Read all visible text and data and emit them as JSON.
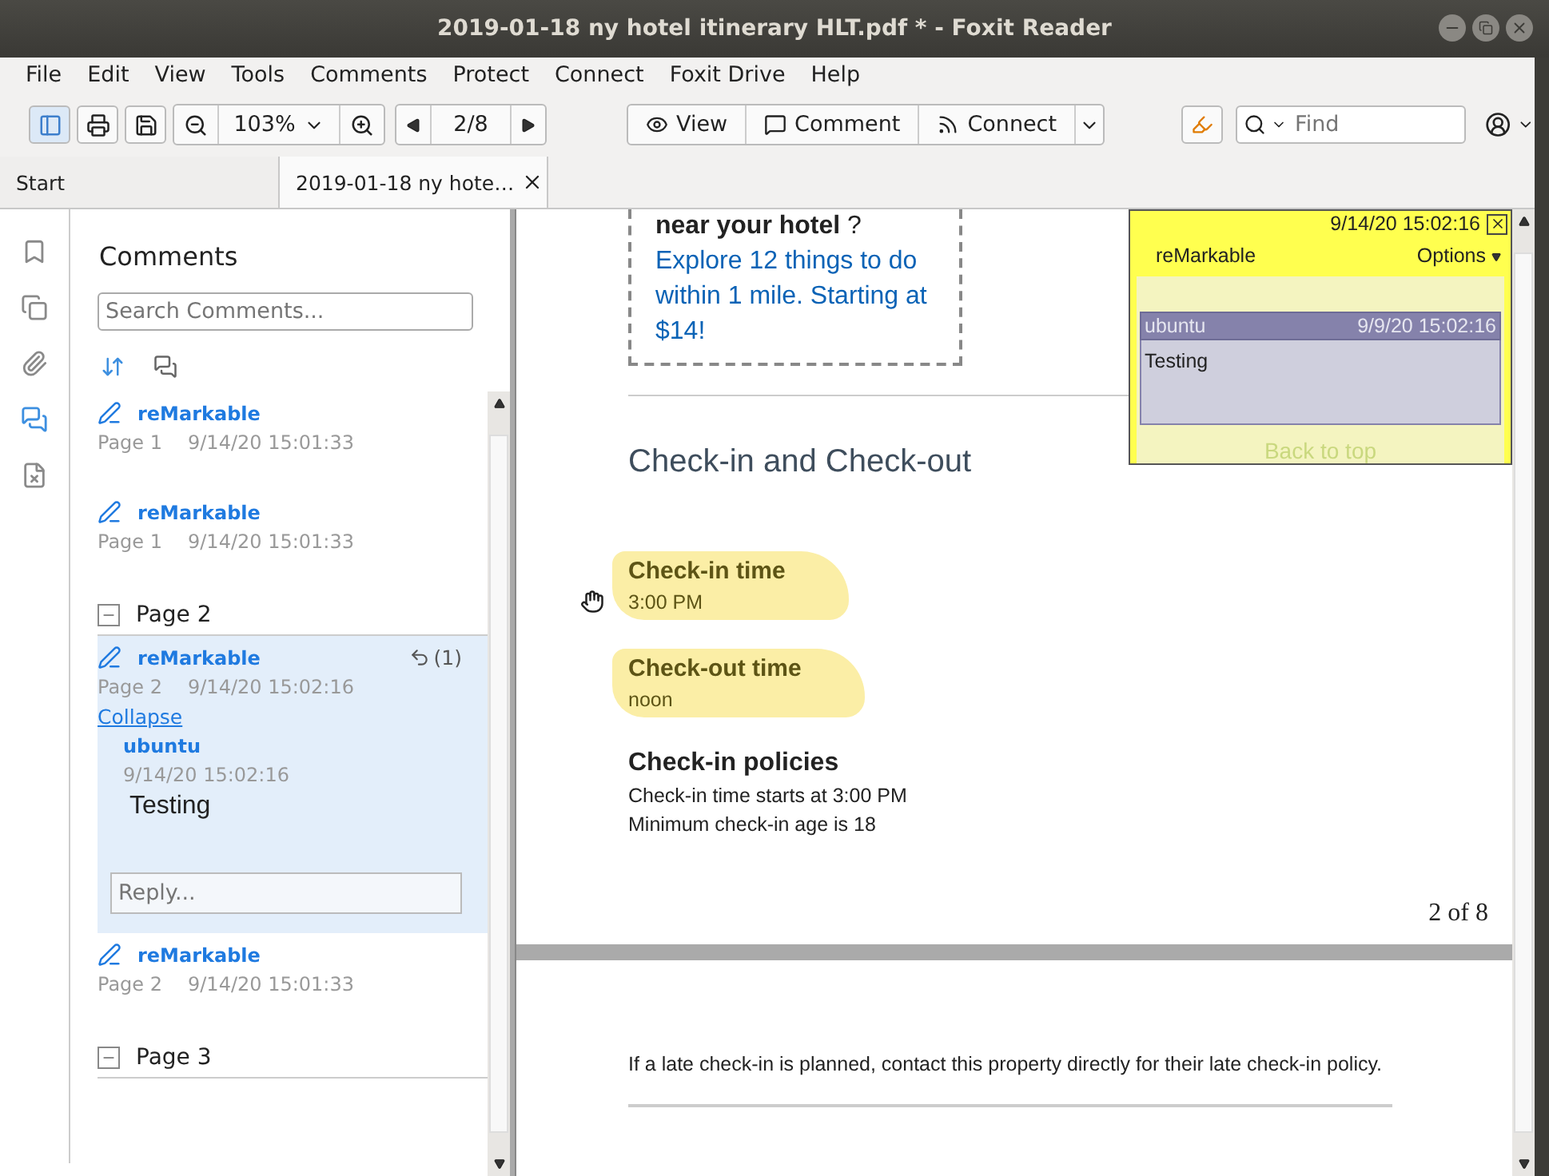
{
  "window": {
    "title": "2019-01-18 ny hotel itinerary HLT.pdf * - Foxit Reader"
  },
  "menu": [
    "File",
    "Edit",
    "View",
    "Tools",
    "Comments",
    "Protect",
    "Connect",
    "Foxit Drive",
    "Help"
  ],
  "toolbar": {
    "zoom": "103%",
    "page": "2/8",
    "modes": [
      {
        "label": "View",
        "kind": "view",
        "selected": false
      },
      {
        "label": "Comment",
        "kind": "comment",
        "selected": false
      },
      {
        "label": "Connect",
        "kind": "connect",
        "selected": false
      }
    ],
    "search": {
      "placeholder": "Find"
    }
  },
  "tabs": [
    {
      "label": "Start",
      "selected": false,
      "closable": false
    },
    {
      "label": "2019-01-18 ny hote…",
      "selected": true,
      "closable": true
    }
  ],
  "rail": [
    {
      "kind": "bookmark",
      "selected": false
    },
    {
      "kind": "pages",
      "selected": false
    },
    {
      "kind": "attachment",
      "selected": false
    },
    {
      "kind": "comments",
      "selected": true
    },
    {
      "kind": "security",
      "selected": false
    }
  ],
  "comments_panel": {
    "title": "Comments",
    "search": {
      "placeholder": "Search Comments..."
    },
    "entries": [
      {
        "kind": "comment",
        "author": "reMarkable",
        "page": "Page 1",
        "time": "9/14/20 15:01:33",
        "selected": false
      },
      {
        "kind": "comment",
        "author": "reMarkable",
        "page": "Page 1",
        "time": "9/14/20 15:01:33",
        "selected": false
      },
      {
        "kind": "group",
        "label": "Page 2",
        "expanded": true
      },
      {
        "kind": "comment",
        "author": "reMarkable",
        "page": "Page 2",
        "time": "9/14/20 15:02:16",
        "selected": true,
        "reply_count": "(1)",
        "collapse": "Collapse",
        "replies": [
          {
            "author": "ubuntu",
            "time": "9/14/20 15:02:16",
            "text": "Testing"
          }
        ],
        "reply_placeholder": "Reply..."
      },
      {
        "kind": "comment",
        "author": "reMarkable",
        "page": "Page 2",
        "time": "9/14/20 15:01:33",
        "selected": false
      },
      {
        "kind": "group",
        "label": "Page 3",
        "expanded": true
      }
    ]
  },
  "document": {
    "promo_heading": "**near your hotel** ?",
    "promo_link": "Explore 12 things to do within 1 mile. Starting at $14!",
    "section_title": "Check-in and Check-out",
    "details": [
      {
        "label": "Check-in time",
        "value": "3:00 PM",
        "highlighted": true
      },
      {
        "label": "Check-out time",
        "value": "noon",
        "highlighted": true
      }
    ],
    "policies": {
      "title": "Check-in policies",
      "lines": [
        "Check-in time starts at 3:00 PM",
        "Minimum check-in age is 18"
      ]
    },
    "page_number": "2 of 8",
    "next_page_text": "If a late check-in is planned, contact this property directly for their late check-in policy."
  },
  "note": {
    "time": "9/14/20 15:02:16",
    "author": "reMarkable",
    "options": "Options",
    "reply": {
      "author": "ubuntu",
      "time": "9/9/20 15:02:16",
      "text": "Testing"
    },
    "underlay_link": "Back to top"
  }
}
